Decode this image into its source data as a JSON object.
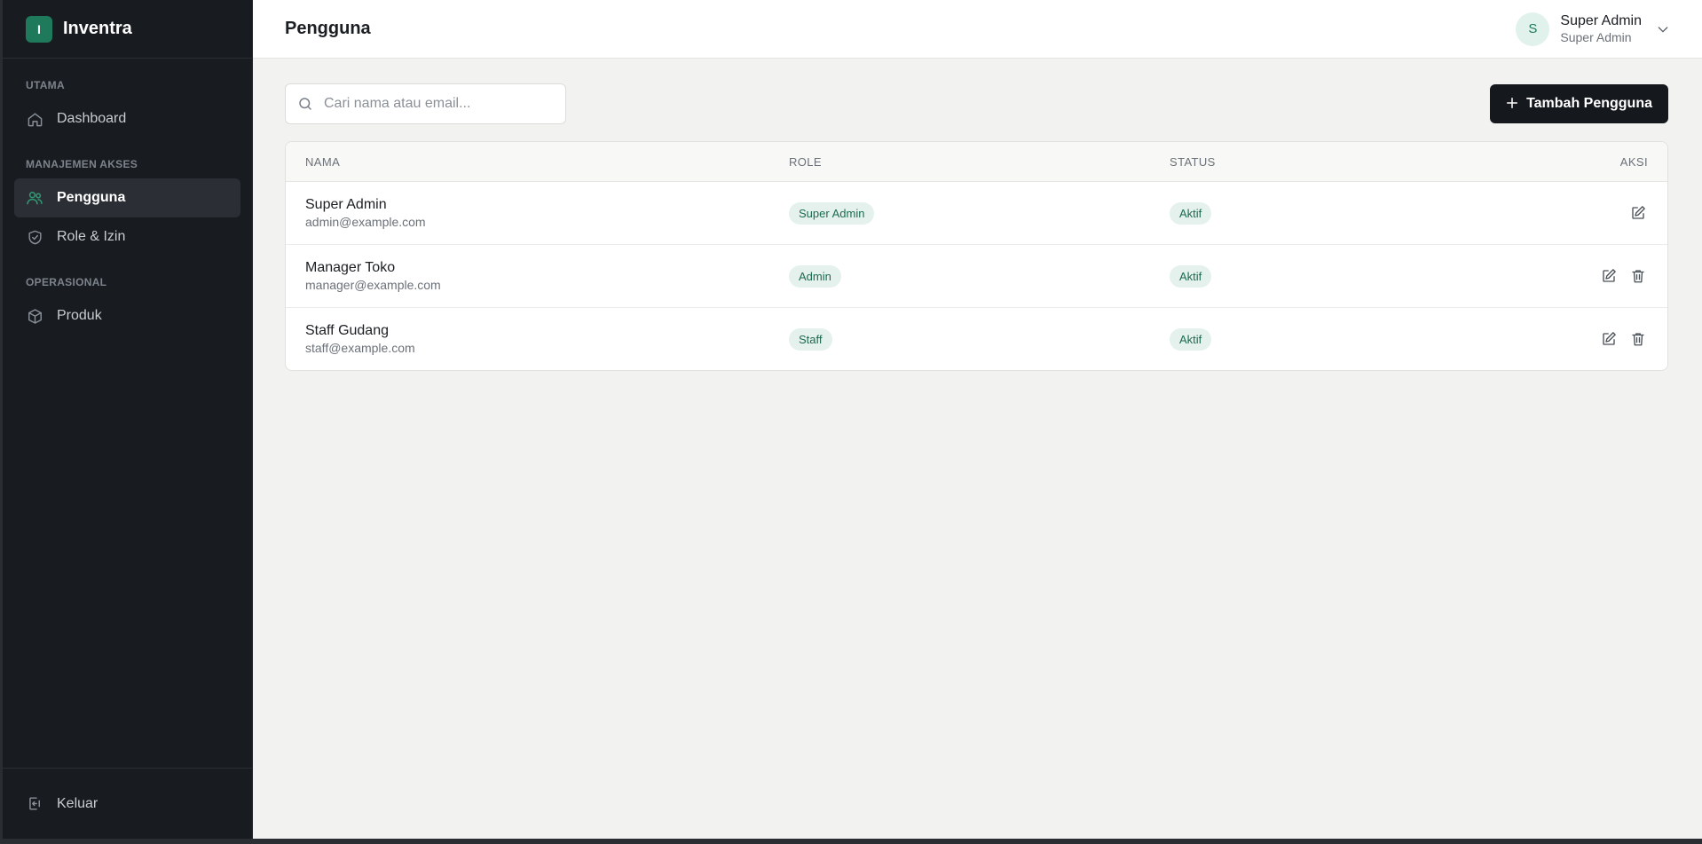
{
  "brand": {
    "logo_letter": "I",
    "name": "Inventra"
  },
  "sidebar": {
    "sections": [
      {
        "label": "UTAMA",
        "items": [
          {
            "label": "Dashboard",
            "icon": "home-icon"
          }
        ]
      },
      {
        "label": "MANAJEMEN AKSES",
        "items": [
          {
            "label": "Pengguna",
            "icon": "users-icon",
            "active": true
          },
          {
            "label": "Role & Izin",
            "icon": "shield-check-icon"
          }
        ]
      },
      {
        "label": "OPERASIONAL",
        "items": [
          {
            "label": "Produk",
            "icon": "box-icon"
          }
        ]
      }
    ],
    "logout_label": "Keluar"
  },
  "header": {
    "title": "Pengguna",
    "user": {
      "initial": "S",
      "name": "Super Admin",
      "role": "Super Admin"
    }
  },
  "search": {
    "placeholder": "Cari nama atau email...",
    "value": ""
  },
  "add_button": {
    "label": "Tambah Pengguna"
  },
  "table": {
    "columns": [
      "NAMA",
      "ROLE",
      "STATUS",
      "AKSI"
    ],
    "rows": [
      {
        "name": "Super Admin",
        "email": "admin@example.com",
        "role": "Super Admin",
        "status": "Aktif",
        "deletable": false
      },
      {
        "name": "Manager Toko",
        "email": "manager@example.com",
        "role": "Admin",
        "status": "Aktif",
        "deletable": true
      },
      {
        "name": "Staff Gudang",
        "email": "staff@example.com",
        "role": "Staff",
        "status": "Aktif",
        "deletable": true
      }
    ]
  },
  "colors": {
    "sidebar_bg": "#181b20",
    "accent": "#1f7a5c",
    "badge_bg": "#e4f1ec",
    "badge_text": "#1b6b50",
    "primary_button": "#15181c"
  }
}
